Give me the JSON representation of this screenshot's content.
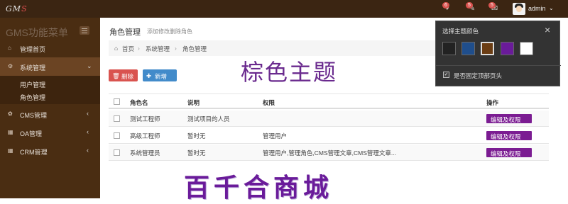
{
  "topbar": {
    "logo_main": "GM",
    "logo_accent": "S",
    "icons": [
      {
        "name": "bell-icon",
        "glyph": "🔔",
        "badge": "6"
      },
      {
        "name": "tasks-icon",
        "glyph": "✎",
        "badge": "5"
      },
      {
        "name": "mail-icon",
        "glyph": "✉",
        "badge": "5"
      }
    ],
    "user": "admin"
  },
  "sidebar": {
    "title": "GMS功能菜单",
    "items": [
      {
        "label": "管理首页",
        "icon": "home-icon"
      },
      {
        "label": "系统管理",
        "icon": "gear-icon"
      },
      {
        "label": "CMS管理",
        "icon": "leaf-icon"
      },
      {
        "label": "OA管理",
        "icon": "sitemap-icon"
      },
      {
        "label": "CRM管理",
        "icon": "table-icon"
      }
    ],
    "sub_items": [
      "用户管理",
      "角色管理"
    ]
  },
  "page": {
    "title": "角色管理",
    "subtitle": "添加修改删除角色",
    "breadcrumb": [
      "首页",
      "系统管理",
      "角色管理"
    ]
  },
  "toolbar": {
    "delete_label": "删除",
    "add_label": "新增"
  },
  "theme_banner": "棕色主题",
  "table": {
    "headers": [
      "角色名",
      "说明",
      "权限",
      "操作"
    ],
    "rows": [
      {
        "name": "测试工程师",
        "desc": "测试项目的人员",
        "perm": "",
        "action": "编辑及权限"
      },
      {
        "name": "高级工程师",
        "desc": "暂时无",
        "perm": "管理用户",
        "action": "编辑及权限"
      },
      {
        "name": "系统管理员",
        "desc": "暂时无",
        "perm": "管理用户,管理角色,CMS管理文章,CMS管理文章...",
        "action": "编辑及权限"
      }
    ]
  },
  "watermark": "百千合商城",
  "theme_panel": {
    "title": "选择主题颜色",
    "colors": [
      "#222222",
      "#1f4e8c",
      "#6b3d14",
      "#6a1b9a",
      "#ffffff"
    ],
    "selected_index": 2,
    "fixed_header_label": "是否固定顶部页头",
    "fixed_header_checked": true
  }
}
